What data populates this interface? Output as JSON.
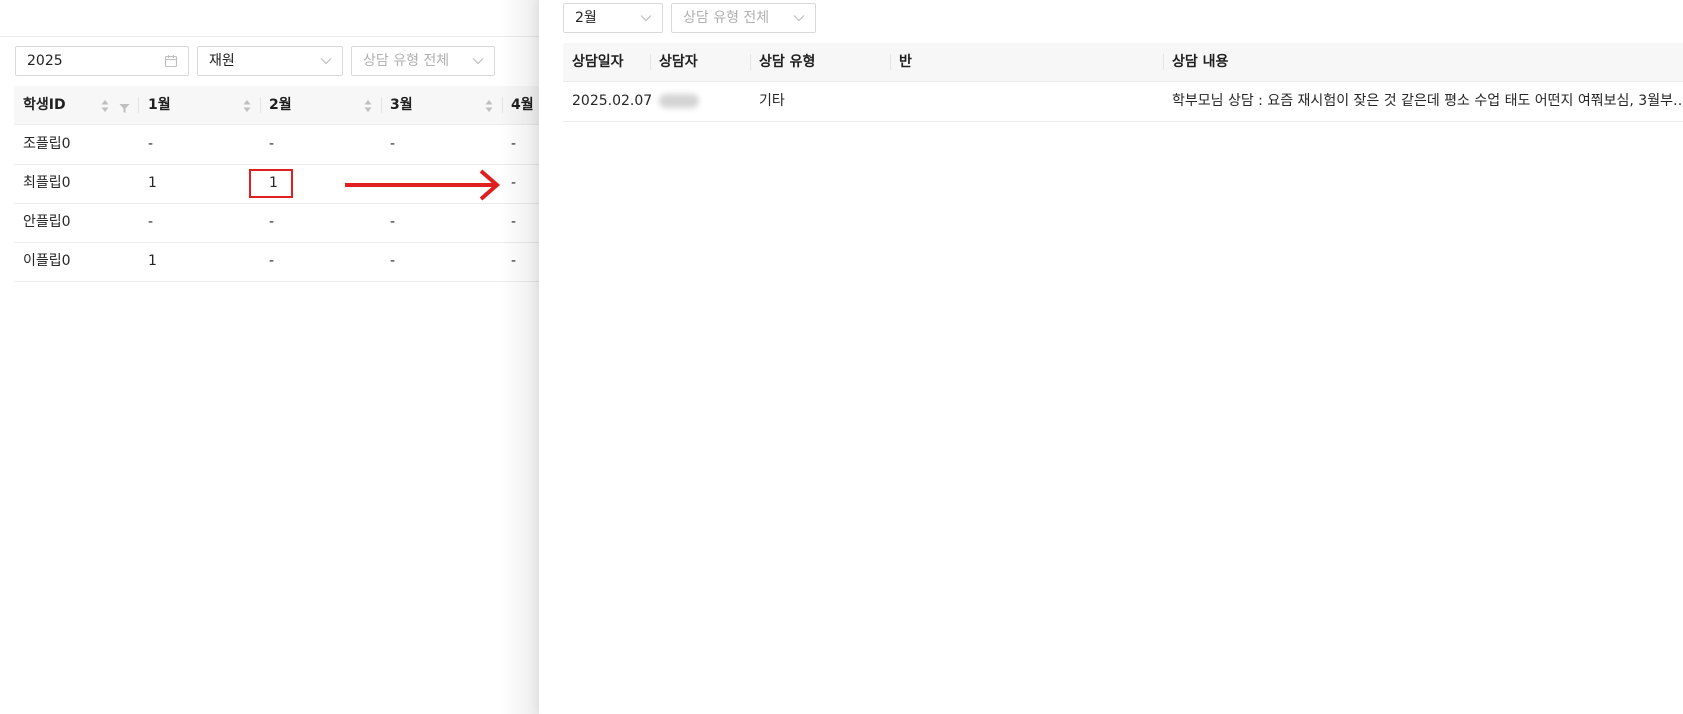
{
  "left": {
    "filters": {
      "year": "2025",
      "status": "재원",
      "type_placeholder": "상담 유형 전체"
    },
    "table": {
      "columns": [
        "학생ID",
        "1월",
        "2월",
        "3월",
        "4월"
      ],
      "rows": [
        {
          "name": "조플립0",
          "m1": "-",
          "m2": "-",
          "m3": "-",
          "m4": "-"
        },
        {
          "name": "최플립0",
          "m1": "1",
          "m2": "1",
          "m3": "",
          "m4": "-"
        },
        {
          "name": "안플립0",
          "m1": "-",
          "m2": "-",
          "m3": "-",
          "m4": "-"
        },
        {
          "name": "이플립0",
          "m1": "1",
          "m2": "-",
          "m3": "-",
          "m4": "-"
        }
      ]
    }
  },
  "annotation": {
    "highlight_color": "#e02020"
  },
  "drawer": {
    "filters": {
      "month": "2월",
      "type_placeholder": "상담 유형 전체"
    },
    "table": {
      "columns": [
        "상담일자",
        "상담자",
        "상담 유형",
        "반",
        "상담 내용"
      ],
      "rows": [
        {
          "date": "2025.02.07",
          "counselor": "",
          "type": "기타",
          "class": "",
          "content": "학부모님 상담 : 요즘 재시험이 잦은 것 같은데 평소 수업 태도 어떤지 여쭤보심, 3월부…"
        }
      ]
    }
  },
  "icons": {
    "calendar": "calendar-icon",
    "dropdown": "chevron-down-icon",
    "sort": "sort-icon",
    "filter": "filter-icon"
  }
}
